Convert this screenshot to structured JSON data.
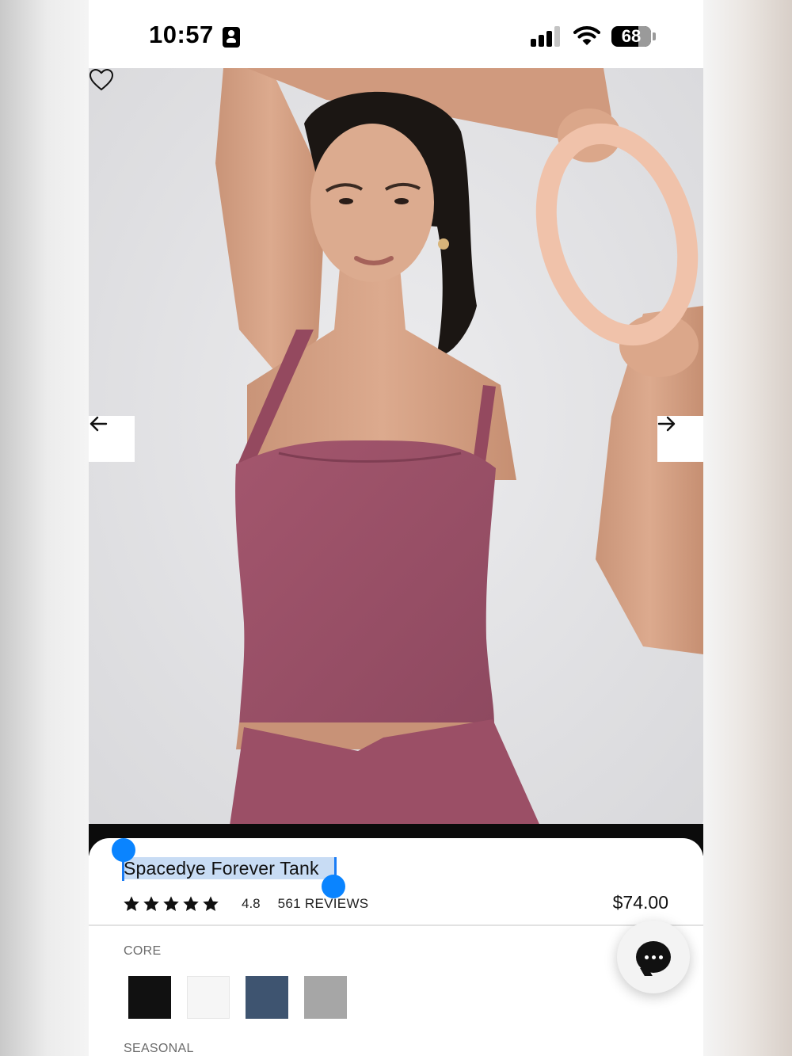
{
  "status_bar": {
    "time": "10:57",
    "battery": "68",
    "battery_level": 0.68,
    "signal_bars": 3,
    "signal_total": 4,
    "icons": [
      "contact-card-icon",
      "cellular-signal-icon",
      "wifi-icon",
      "battery-icon"
    ]
  },
  "gallery": {
    "prev_icon": "arrow-left-icon",
    "next_icon": "arrow-right-icon",
    "wishlist_icon": "heart-icon"
  },
  "product": {
    "title": "Spacedye Forever Tank",
    "rating_value": "4.8",
    "rating_stars": 5,
    "reviews_label": "561 REVIEWS",
    "price": "$74.00"
  },
  "colors": {
    "sections": [
      {
        "label": "CORE",
        "swatches": [
          {
            "name": "black",
            "hex": "#111111"
          },
          {
            "name": "white",
            "hex": "#f6f6f6"
          },
          {
            "name": "navy",
            "hex": "#3e5470"
          },
          {
            "name": "grey",
            "hex": "#a6a6a6"
          }
        ]
      },
      {
        "label": "SEASONAL",
        "swatches": []
      }
    ]
  },
  "chat": {
    "icon": "chat-bubble-icon"
  },
  "theme": {
    "selection_highlight": "#c8dcf4",
    "selection_handle": "#0a84ff",
    "tank_color": "#9a4f66"
  }
}
